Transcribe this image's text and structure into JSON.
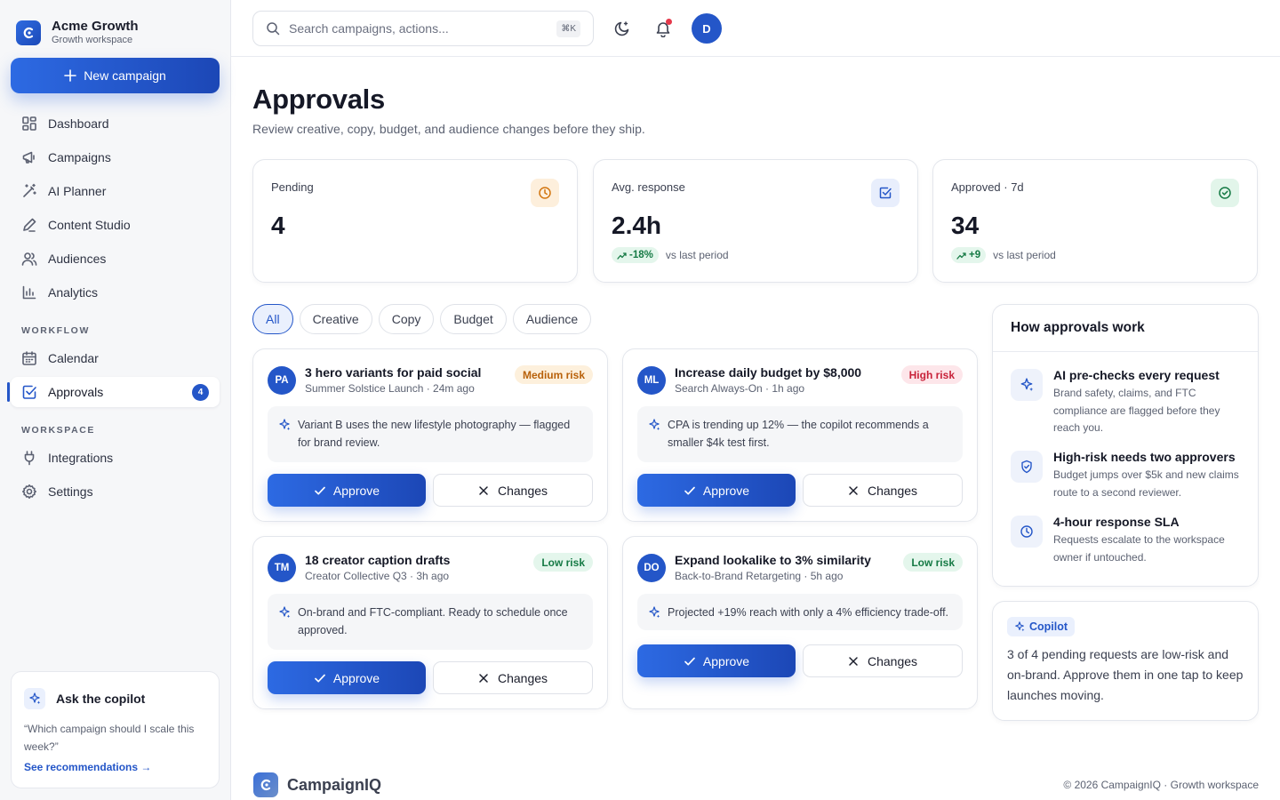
{
  "brand": {
    "name": "Acme Growth",
    "workspace": "Growth workspace"
  },
  "sidebar": {
    "new_campaign_label": "New campaign",
    "main_items": [
      {
        "label": "Dashboard",
        "icon": "grid-icon"
      },
      {
        "label": "Campaigns",
        "icon": "megaphone-icon"
      },
      {
        "label": "AI Planner",
        "icon": "magic-wand-icon"
      },
      {
        "label": "Content Studio",
        "icon": "pen-icon"
      },
      {
        "label": "Audiences",
        "icon": "users-icon"
      },
      {
        "label": "Analytics",
        "icon": "bar-chart-icon"
      }
    ],
    "workflow_title": "WORKFLOW",
    "workflow_items": [
      {
        "label": "Calendar",
        "icon": "calendar-icon"
      },
      {
        "label": "Approvals",
        "icon": "check-square-icon",
        "badge": "4",
        "active": true
      }
    ],
    "workspace_title": "WORKSPACE",
    "workspace_items": [
      {
        "label": "Integrations",
        "icon": "plug-icon"
      },
      {
        "label": "Settings",
        "icon": "gear-icon"
      }
    ],
    "copilot": {
      "title": "Ask the copilot",
      "question": "“Which campaign should I scale this week?”",
      "link": "See recommendations →"
    }
  },
  "topbar": {
    "search_placeholder": "Search campaigns, actions...",
    "shortcut": "⌘K",
    "avatar_initial": "D"
  },
  "page": {
    "title": "Approvals",
    "subtitle": "Review creative, copy, budget, and audience changes before they ship."
  },
  "stats": [
    {
      "label": "Pending",
      "value": "4"
    },
    {
      "label": "Avg. response",
      "value": "2.4h",
      "delta": "-18%",
      "delta_note": "vs last period"
    },
    {
      "label": "Approved · 7d",
      "value": "34",
      "delta": "+9",
      "delta_note": "vs last period"
    }
  ],
  "filters": [
    "All",
    "Creative",
    "Copy",
    "Budget",
    "Audience"
  ],
  "requests": [
    {
      "initials": "PA",
      "title": "3 hero variants for paid social",
      "meta": "Summer Solstice Launch · 24m ago",
      "risk": "Medium risk",
      "note": "Variant B uses the new lifestyle photography — flagged for brand review."
    },
    {
      "initials": "ML",
      "title": "Increase daily budget by $8,000",
      "meta": "Search Always-On · 1h ago",
      "risk": "High risk",
      "note": "CPA is trending up 12% — the copilot recommends a smaller $4k test first."
    },
    {
      "initials": "TM",
      "title": "18 creator caption drafts",
      "meta": "Creator Collective Q3 · 3h ago",
      "risk": "Low risk",
      "note": "On-brand and FTC-compliant. Ready to schedule once approved."
    },
    {
      "initials": "DO",
      "title": "Expand lookalike to 3% similarity",
      "meta": "Back-to-Brand Retargeting · 5h ago",
      "risk": "Low risk",
      "note": "Projected +19% reach with only a 4% efficiency trade-off."
    }
  ],
  "actions": {
    "approve": "Approve",
    "changes": "Changes"
  },
  "how": {
    "title": "How approvals work",
    "items": [
      {
        "title": "AI pre-checks every request",
        "desc": "Brand safety, claims, and FTC compliance are flagged before they reach you."
      },
      {
        "title": "High-risk needs two approvers",
        "desc": "Budget jumps over $5k and new claims route to a second reviewer."
      },
      {
        "title": "4-hour response SLA",
        "desc": "Requests escalate to the workspace owner if untouched."
      }
    ]
  },
  "tip": {
    "badge": "Copilot",
    "text": "3 of 4 pending requests are low-risk and on-brand. Approve them in one tap to keep launches moving."
  },
  "footer": {
    "brand": "CampaignIQ",
    "copyright": "© 2026 CampaignIQ · Growth workspace"
  },
  "colors": {
    "primary": "#2456c8",
    "success": "#167a45",
    "warning": "#b8610a",
    "danger": "#c8223a"
  }
}
